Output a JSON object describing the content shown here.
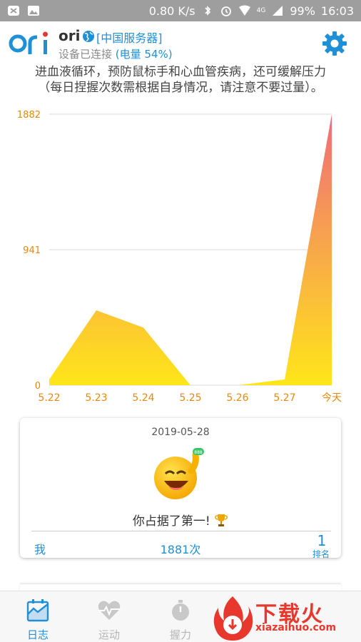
{
  "status_bar": {
    "speed": "0.80 K/s",
    "battery": "99%",
    "time": "16:03",
    "network": "4G"
  },
  "app": {
    "name": "ori",
    "server": "[中国服务器]",
    "connection": "设备已连接",
    "battery_label": "(电量 54%)"
  },
  "description": {
    "line1": "进血液循环，预防鼠标手和心血管疾病，还可缓解压力",
    "line2": "（每日捏握次数需根据自身情况，请注意不要过量）。"
  },
  "chart_data": {
    "type": "area",
    "x": [
      "5.22",
      "5.23",
      "5.24",
      "5.25",
      "5.26",
      "5.27",
      "今天"
    ],
    "y_ticks": [
      "0",
      "941",
      "1882"
    ],
    "ylim": [
      0,
      1882
    ],
    "segments": [
      {
        "x": [
          0,
          1,
          2,
          3
        ],
        "y": [
          40,
          520,
          400,
          0
        ]
      },
      {
        "x": [
          4,
          5,
          6
        ],
        "y": [
          0,
          40,
          1881
        ]
      }
    ],
    "colors": {
      "top": "#f06a7a",
      "bottom": "#ffe619",
      "grid": "#d8d8d8",
      "labels": "#e8880f"
    }
  },
  "card": {
    "date": "2019-05-28",
    "message": "你占据了第一!",
    "me_label": "我",
    "count": "1881次",
    "rank": "1",
    "rank_label": "排名"
  },
  "nav": {
    "items": [
      {
        "label": "日志",
        "icon": "log-chart-icon",
        "active": true
      },
      {
        "label": "运动",
        "icon": "heart-pulse-icon",
        "active": false
      },
      {
        "label": "握力",
        "icon": "stopwatch-icon",
        "active": false
      }
    ]
  },
  "watermark": {
    "text": "下载火",
    "url": "xiazaihuo.com"
  }
}
